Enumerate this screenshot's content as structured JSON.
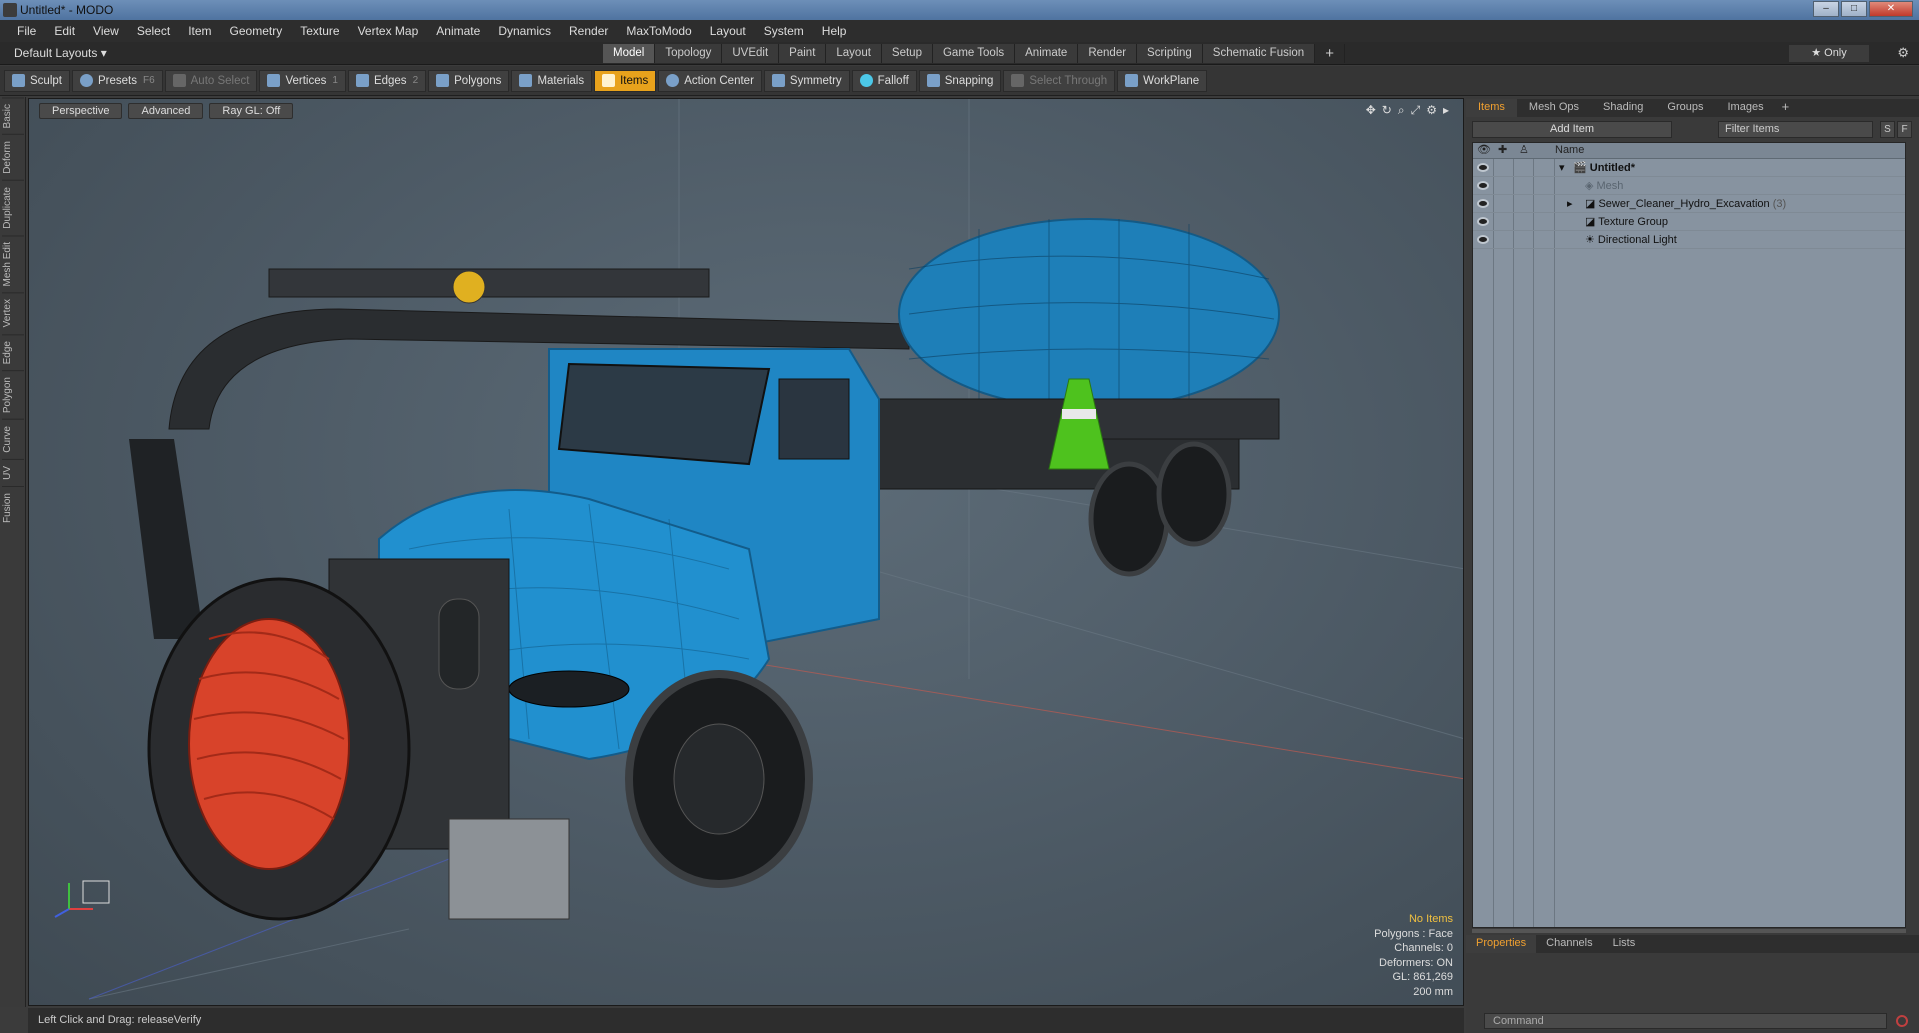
{
  "window": {
    "title": "Untitled* - MODO",
    "min": "–",
    "max": "□",
    "close": "✕"
  },
  "menu": [
    "File",
    "Edit",
    "View",
    "Select",
    "Item",
    "Geometry",
    "Texture",
    "Vertex Map",
    "Animate",
    "Dynamics",
    "Render",
    "MaxToModo",
    "Layout",
    "System",
    "Help"
  ],
  "layout": {
    "default_label": "Default Layouts ▾",
    "tabs": [
      "Model",
      "Topology",
      "UVEdit",
      "Paint",
      "Layout",
      "Setup",
      "Game Tools",
      "Animate",
      "Render",
      "Scripting",
      "Schematic Fusion"
    ],
    "active_tab": "Model",
    "plus": "+",
    "only": "★ Only",
    "gear": "⚙"
  },
  "toolbar": {
    "sculpt": "Sculpt",
    "presets": "Presets",
    "presets_key": "F6",
    "auto_select": "Auto Select",
    "vertices": "Vertices",
    "vertices_n": "1",
    "edges": "Edges",
    "edges_n": "2",
    "polygons": "Polygons",
    "materials": "Materials",
    "items": "Items",
    "action_center": "Action Center",
    "symmetry": "Symmetry",
    "falloff": "Falloff",
    "snapping": "Snapping",
    "select_through": "Select Through",
    "workplane": "WorkPlane"
  },
  "left_tabs": [
    "Basic",
    "Deform",
    "Duplicate",
    "Mesh Edit",
    "Vertex",
    "Edge",
    "Polygon",
    "Curve",
    "UV",
    "Fusion"
  ],
  "viewport": {
    "view": "Perspective",
    "shading": "Advanced",
    "raygl": "Ray GL: Off",
    "stats": {
      "items": "No Items",
      "polygons": "Polygons : Face",
      "channels": "Channels: 0",
      "deformers": "Deformers: ON",
      "gl": "GL: 861,269",
      "scale": "200 mm"
    }
  },
  "status": {
    "text": "Left Click and Drag:   releaseVerify"
  },
  "right_panel": {
    "tabs": [
      "Items",
      "Mesh Ops",
      "Shading",
      "Groups",
      "Images"
    ],
    "active_tab": "Items",
    "plus": "+",
    "add_item": "Add Item",
    "filter": "Filter Items",
    "s_btn": "S",
    "f_btn": "F",
    "col_name": "Name",
    "items": [
      {
        "label": "Untitled*",
        "bold": true,
        "indent": 0
      },
      {
        "label": "Mesh",
        "dim": true,
        "indent": 1
      },
      {
        "label": "Sewer_Cleaner_Hydro_Excavation",
        "count": "(3)",
        "indent": 1
      },
      {
        "label": "Texture Group",
        "indent": 1
      },
      {
        "label": "Directional Light",
        "indent": 1
      }
    ],
    "bottom_tabs": [
      "Properties",
      "Channels",
      "Lists"
    ],
    "bottom_active": "Properties",
    "command_placeholder": "Command"
  },
  "colors": {
    "accent": "#e8a21c",
    "truck_blue": "#1e7fb8",
    "hose_red": "#d8432a",
    "cone_green": "#4ec21e"
  }
}
